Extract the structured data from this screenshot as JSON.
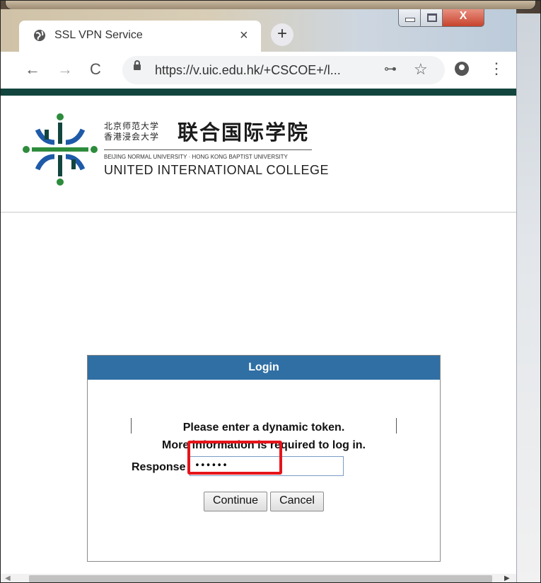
{
  "browser": {
    "tab_title": "SSL VPN Service",
    "tab_close_icon": "×",
    "new_tab_icon": "+",
    "url": "https://v.uic.edu.hk/+CSCOE+/l...",
    "back_icon": "←",
    "forward_icon": "→",
    "reload_icon": "C",
    "key_icon": "⊶",
    "star_icon": "☆",
    "menu_icon": "⋮",
    "window_close_label": "X"
  },
  "header": {
    "cn_line1": "北京师范大学",
    "cn_line2": "香港浸会大学",
    "cn_name": "联合国际学院",
    "en_small": "BEIJING NORMAL UNIVERSITY · HONG KONG BAPTIST UNIVERSITY",
    "en_name": "UNITED INTERNATIONAL COLLEGE",
    "colors": {
      "teal": "#12453e",
      "blue": "#1e5aa8",
      "green": "#2d8c3c"
    }
  },
  "login": {
    "title": "Login",
    "message_line1": "Please enter a dynamic token.",
    "message_line2": "More information is required to log in.",
    "response_label": "Response",
    "response_value": "••••••",
    "continue_label": "Continue",
    "cancel_label": "Cancel",
    "header_color": "#2f6fa4"
  },
  "scrollbar": {
    "left_arrow": "◀",
    "right_arrow": "▶"
  }
}
